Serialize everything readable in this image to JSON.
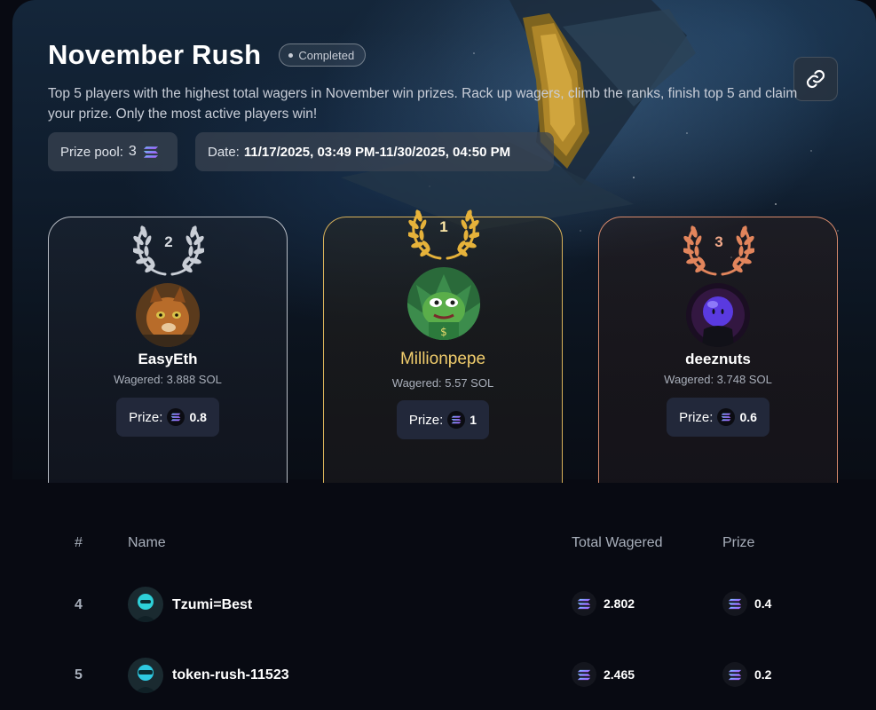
{
  "header": {
    "title": "November Rush",
    "status": "Completed",
    "description": "Top 5 players with the highest total wagers in November win prizes. Rack up wagers, climb the ranks, finish top 5 and claim your prize. Only the most active players win!",
    "prize_pool_label": "Prize pool:",
    "prize_pool_value": "3",
    "date_label": "Date:",
    "date_value": "11/17/2025, 03:49 PM-11/30/2025, 04:50 PM"
  },
  "podium": {
    "second": {
      "rank": "2",
      "name": "EasyEth",
      "wagered": "Wagered: 3.888 SOL",
      "prize_label": "Prize:",
      "prize": "0.8"
    },
    "first": {
      "rank": "1",
      "name": "Millionpepe",
      "wagered": "Wagered: 5.57 SOL",
      "prize_label": "Prize:",
      "prize": "1"
    },
    "third": {
      "rank": "3",
      "name": "deeznuts",
      "wagered": "Wagered: 3.748 SOL",
      "prize_label": "Prize:",
      "prize": "0.6"
    }
  },
  "table": {
    "headers": {
      "rank": "#",
      "name": "Name",
      "wagered": "Total Wagered",
      "prize": "Prize"
    },
    "rows": [
      {
        "rank": "4",
        "name": "Tzumi=Best",
        "wagered": "2.802",
        "prize": "0.4"
      },
      {
        "rank": "5",
        "name": "token-rush-11523",
        "wagered": "2.465",
        "prize": "0.2"
      }
    ]
  },
  "icons": {
    "link": "link-icon",
    "currency": "solana-icon",
    "rank_decoration": "laurel-wreath-icon"
  },
  "colors": {
    "gold": "#f0cc6c",
    "silver": "#b7bcc4",
    "bronze": "#d88a6c",
    "background": "#080a12"
  }
}
